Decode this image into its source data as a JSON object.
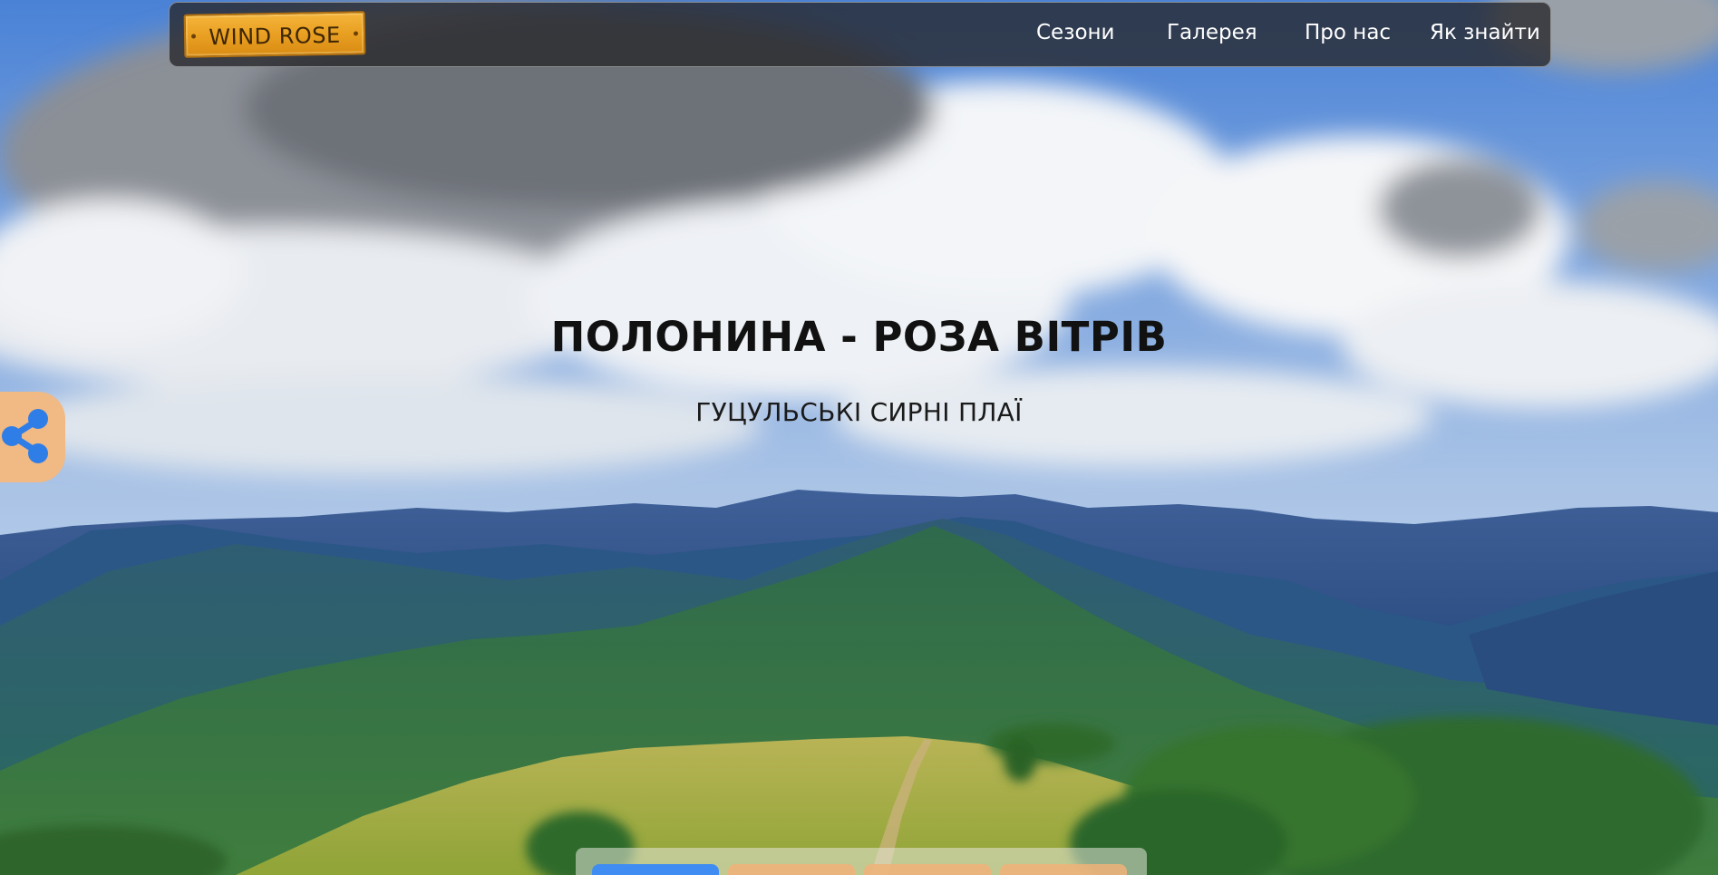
{
  "navbar": {
    "logo_text": "WIND ROSE",
    "items": [
      {
        "label": "Сезони"
      },
      {
        "label": "Галерея"
      },
      {
        "label": "Про нас"
      },
      {
        "label": "Як знайти"
      }
    ]
  },
  "hero": {
    "title": "ПОЛОНИНА - РОЗА ВІТРІВ",
    "subtitle": "ГУЦУЛЬСЬКІ СИРНІ ПЛАЇ"
  },
  "share": {
    "icon": "share-icon"
  },
  "colors": {
    "accent_blue": "#3f8df2",
    "accent_orange": "#f1b983",
    "logo_wood": "#e9a022",
    "navbar_bg": "#26262a"
  }
}
